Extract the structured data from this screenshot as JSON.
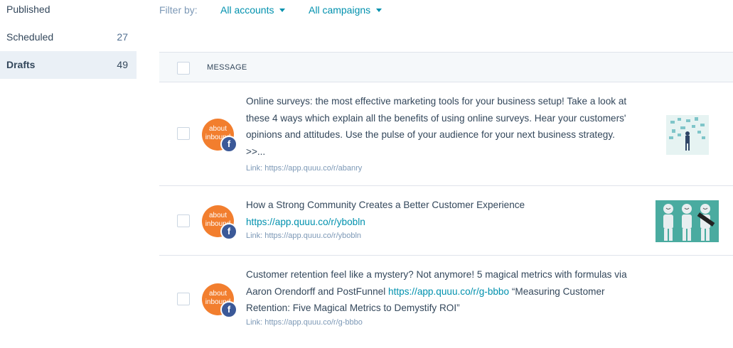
{
  "sidebar": {
    "items": [
      {
        "label": "Published",
        "count": ""
      },
      {
        "label": "Scheduled",
        "count": "27"
      },
      {
        "label": "Drafts",
        "count": "49"
      }
    ]
  },
  "filter": {
    "label": "Filter by:",
    "accounts": "All accounts",
    "campaigns": "All campaigns"
  },
  "table": {
    "header": "MESSAGE",
    "rows": [
      {
        "avatar_text": "about inbound",
        "text": "Online surveys: the most effective marketing tools for your business setup! Take a look at these 4 ways which explain all the benefits of using online surveys. Hear your customers' opinions and attitudes. Use the pulse of your audience for your next business strategy. >>...",
        "link": "Link: https://app.quuu.co/r/abanry"
      },
      {
        "avatar_text": "about inbound",
        "text_before": "How a Strong Community Creates a Better Customer Experience",
        "url": "https://app.quuu.co/r/ybobln",
        "link": "Link: https://app.quuu.co/r/ybobln"
      },
      {
        "avatar_text": "about inbound",
        "text_before": "Customer retention feel like a mystery? Not anymore! 5 magical metrics with formulas via Aaron Orendorff and PostFunnel",
        "url": "https://app.quuu.co/r/g-bbbo",
        "text_after": "“Measuring Customer Retention: Five Magical Metrics to Demystify ROI”",
        "link": "Link: https://app.quuu.co/r/g-bbbo"
      }
    ]
  },
  "colors": {
    "accent": "#0091ae",
    "avatar": "#f27e2e",
    "facebook": "#3b5998",
    "active_bg": "#eaf0f6"
  },
  "icons": {
    "caret": "caret-down-icon",
    "facebook": "facebook-icon"
  }
}
